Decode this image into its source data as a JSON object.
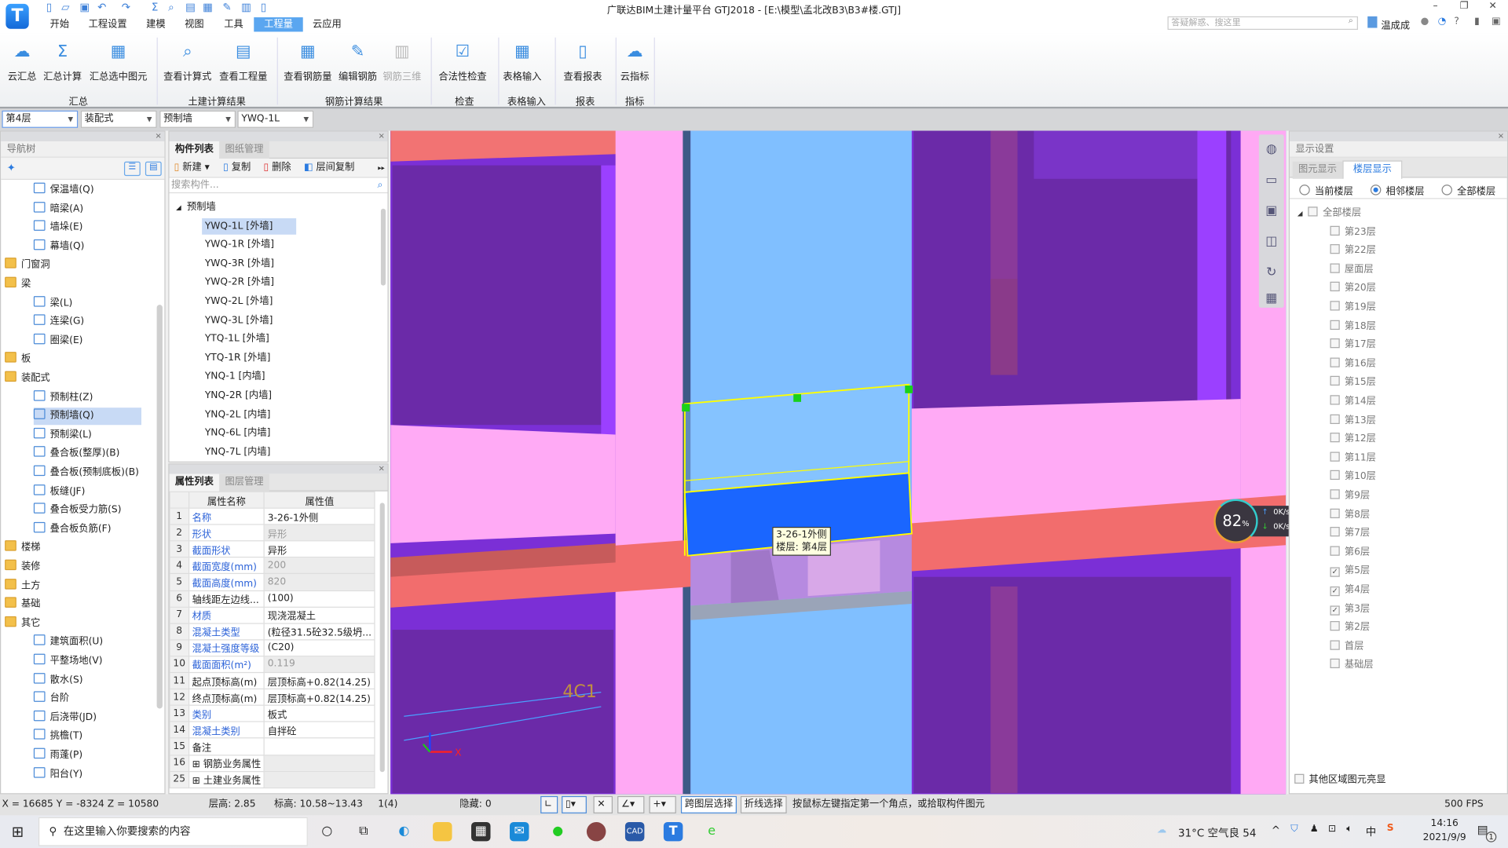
{
  "app": {
    "title": "广联达BIM土建计量平台 GTJ2018 - [E:\\模型\\孟北改B3\\B3#楼.GTJ]",
    "logo_letter": "T",
    "user": "温成成",
    "search_placeholder": "答疑解惑、搜这里"
  },
  "quick_access": [
    "new-file-icon",
    "open-folder-icon",
    "save-icon",
    "undo-icon",
    "redo-icon",
    "sum-icon",
    "view-formula-icon",
    "view-quantity-icon",
    "view-rebar-icon",
    "edit-rebar-icon",
    "rebar-3d-icon",
    "report-icon"
  ],
  "menu_tabs": [
    "开始",
    "工程设置",
    "建模",
    "视图",
    "工具",
    "工程量",
    "云应用"
  ],
  "menu_selected": "工程量",
  "ribbon": {
    "groups": [
      {
        "label": "汇总",
        "buttons": [
          {
            "label": "云汇总",
            "icon": "cloud-sum-icon"
          },
          {
            "label": "汇总计算",
            "icon": "sigma-icon"
          },
          {
            "label": "汇总选中图元",
            "icon": "sum-selected-icon"
          }
        ]
      },
      {
        "label": "土建计算结果",
        "buttons": [
          {
            "label": "查看计算式",
            "icon": "view-formula-icon"
          },
          {
            "label": "查看工程量",
            "icon": "view-quantity-icon"
          }
        ]
      },
      {
        "label": "钢筋计算结果",
        "buttons": [
          {
            "label": "查看钢筋量",
            "icon": "view-rebar-icon"
          },
          {
            "label": "编辑钢筋",
            "icon": "edit-rebar-icon"
          },
          {
            "label": "钢筋三维",
            "icon": "rebar-3d-icon",
            "disabled": true
          }
        ]
      },
      {
        "label": "检查",
        "buttons": [
          {
            "label": "合法性检查",
            "icon": "check-icon"
          }
        ]
      },
      {
        "label": "表格输入",
        "buttons": [
          {
            "label": "表格输入",
            "icon": "table-input-icon"
          }
        ]
      },
      {
        "label": "报表",
        "buttons": [
          {
            "label": "查看报表",
            "icon": "report-icon"
          }
        ]
      },
      {
        "label": "指标",
        "buttons": [
          {
            "label": "云指标",
            "icon": "cloud-index-icon"
          }
        ]
      }
    ]
  },
  "selectors": [
    "第4层",
    "装配式",
    "预制墙",
    "YWQ-1L"
  ],
  "nav": {
    "title": "导航树",
    "items": [
      {
        "label": "保温墙(Q)"
      },
      {
        "label": "暗梁(A)"
      },
      {
        "label": "墙垛(E)"
      },
      {
        "label": "幕墙(Q)"
      },
      {
        "label": "门窗洞",
        "group": true
      },
      {
        "label": "梁",
        "group": true
      },
      {
        "label": "梁(L)"
      },
      {
        "label": "连梁(G)"
      },
      {
        "label": "圈梁(E)"
      },
      {
        "label": "板",
        "group": true
      },
      {
        "label": "装配式",
        "group": true
      },
      {
        "label": "预制柱(Z)"
      },
      {
        "label": "预制墙(Q)",
        "selected": true
      },
      {
        "label": "预制梁(L)"
      },
      {
        "label": "叠合板(整厚)(B)"
      },
      {
        "label": "叠合板(预制底板)(B)"
      },
      {
        "label": "板缝(JF)"
      },
      {
        "label": "叠合板受力筋(S)"
      },
      {
        "label": "叠合板负筋(F)"
      },
      {
        "label": "楼梯",
        "group": true
      },
      {
        "label": "装修",
        "group": true
      },
      {
        "label": "土方",
        "group": true
      },
      {
        "label": "基础",
        "group": true
      },
      {
        "label": "其它",
        "group": true
      },
      {
        "label": "建筑面积(U)"
      },
      {
        "label": "平整场地(V)"
      },
      {
        "label": "散水(S)"
      },
      {
        "label": "台阶"
      },
      {
        "label": "后浇带(JD)"
      },
      {
        "label": "挑檐(T)"
      },
      {
        "label": "雨蓬(P)"
      },
      {
        "label": "阳台(Y)"
      }
    ]
  },
  "components": {
    "tabs": [
      "构件列表",
      "图纸管理"
    ],
    "toolbar": [
      "新建",
      "复制",
      "删除",
      "层间复制"
    ],
    "search_placeholder": "搜索构件...",
    "group": "预制墙",
    "items": [
      "YWQ-1L [外墙]",
      "YWQ-1R [外墙]",
      "YWQ-3R [外墙]",
      "YWQ-2R [外墙]",
      "YWQ-2L [外墙]",
      "YWQ-3L [外墙]",
      "YTQ-1L [外墙]",
      "YTQ-1R [外墙]",
      "YNQ-1 [内墙]",
      "YNQ-2R [内墙]",
      "YNQ-2L [内墙]",
      "YNQ-6L [内墙]",
      "YNQ-7L [内墙]"
    ],
    "selected": "YWQ-1L [外墙]"
  },
  "properties": {
    "tabs": [
      "属性列表",
      "图层管理"
    ],
    "headers": [
      "属性名称",
      "属性值"
    ],
    "rows": [
      {
        "n": "1",
        "name": "名称",
        "value": "3-26-1外侧",
        "blue": true
      },
      {
        "n": "2",
        "name": "形状",
        "value": "异形",
        "blue": true,
        "ro": true
      },
      {
        "n": "3",
        "name": "截面形状",
        "value": "异形",
        "blue": true
      },
      {
        "n": "4",
        "name": "截面宽度(mm)",
        "value": "200",
        "blue": true,
        "ro": true
      },
      {
        "n": "5",
        "name": "截面高度(mm)",
        "value": "820",
        "blue": true,
        "ro": true
      },
      {
        "n": "6",
        "name": "轴线距左边线...",
        "value": "(100)"
      },
      {
        "n": "7",
        "name": "材质",
        "value": "现浇混凝土",
        "blue": true
      },
      {
        "n": "8",
        "name": "混凝土类型",
        "value": "(粒径31.5砼32.5级坍...",
        "blue": true
      },
      {
        "n": "9",
        "name": "混凝土强度等级",
        "value": "(C20)",
        "blue": true
      },
      {
        "n": "10",
        "name": "截面面积(m²)",
        "value": "0.119",
        "blue": true,
        "ro": true
      },
      {
        "n": "11",
        "name": "起点顶标高(m)",
        "value": "层顶标高+0.82(14.25)"
      },
      {
        "n": "12",
        "name": "终点顶标高(m)",
        "value": "层顶标高+0.82(14.25)"
      },
      {
        "n": "13",
        "name": "类别",
        "value": "板式",
        "blue": true
      },
      {
        "n": "14",
        "name": "混凝土类别",
        "value": "自拌砼",
        "blue": true
      },
      {
        "n": "15",
        "name": "备注",
        "value": ""
      },
      {
        "n": "16",
        "name": "⊞ 钢筋业务属性",
        "value": "",
        "ro": true
      },
      {
        "n": "25",
        "name": "⊞ 土建业务属性",
        "value": "",
        "ro": true
      }
    ]
  },
  "viewport": {
    "tooltip": [
      "3-26-1外侧",
      "楼层: 第4层"
    ],
    "axis_label": "X",
    "drawing_text": "4C1",
    "gauge": {
      "percent": 82,
      "upload": "0K/s",
      "download": "0K/s"
    }
  },
  "display_settings": {
    "title": "显示设置",
    "tabs": [
      "图元显示",
      "楼层显示"
    ],
    "active_tab": "楼层显示",
    "radios": [
      {
        "label": "当前楼层",
        "on": false
      },
      {
        "label": "相邻楼层",
        "on": true
      },
      {
        "label": "全部楼层",
        "on": false
      }
    ],
    "all_label": "全部楼层",
    "floors": [
      {
        "label": "第23层"
      },
      {
        "label": "第22层"
      },
      {
        "label": "屋面层"
      },
      {
        "label": "第20层"
      },
      {
        "label": "第19层"
      },
      {
        "label": "第18层"
      },
      {
        "label": "第17层"
      },
      {
        "label": "第16层"
      },
      {
        "label": "第15层"
      },
      {
        "label": "第14层"
      },
      {
        "label": "第13层"
      },
      {
        "label": "第12层"
      },
      {
        "label": "第11层"
      },
      {
        "label": "第10层"
      },
      {
        "label": "第9层"
      },
      {
        "label": "第8层"
      },
      {
        "label": "第7层"
      },
      {
        "label": "第6层"
      },
      {
        "label": "第5层",
        "checked": true
      },
      {
        "label": "第4层",
        "checked": true
      },
      {
        "label": "第3层",
        "checked": true
      },
      {
        "label": "第2层"
      },
      {
        "label": "首层"
      },
      {
        "label": "基础层"
      }
    ],
    "footer": "其他区域图元亮显"
  },
  "status": {
    "coords": "X = 16685 Y = -8324 Z = 10580",
    "floor_height": "层高:  2.85",
    "elevation": "标高:  10.58~13.43",
    "count": "1(4)",
    "hidden": "隐藏:  0",
    "cross_layer": "跨图层选择",
    "polyline": "折线选择",
    "hint": "按鼠标左键指定第一个角点，或拾取构件图元",
    "fps": "500 FPS"
  },
  "taskbar": {
    "search_placeholder": "在这里输入你要搜索的内容",
    "weather": "31°C  空气良 54",
    "time": "14:16",
    "date": "2021/9/9",
    "notifications": "1"
  },
  "colors": {
    "accent": "#5aa6f0",
    "selected_wall": "#1a66ff",
    "highlight": "#ffff00",
    "pink": "#ffaaf5",
    "purple": "#7b2fd6",
    "beam": "#f26d6d",
    "column": "#80bfff"
  }
}
